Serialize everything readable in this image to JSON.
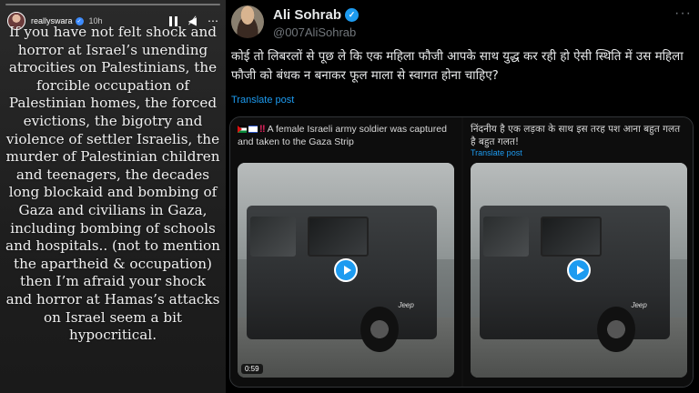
{
  "story": {
    "username": "reallyswara",
    "time": "10h",
    "text": "If you have not felt shock and horror at Israel’s unending atrocities on Palestinians, the forcible occupation of Palestinian homes, the forced evictions, the bigotry and violence of settler Israelis, the murder of Palestinian children and teenagers, the decades long blockaid and bombing of Gaza and civilians in Gaza, including bombing of schools and hospitals.. (not to mention the apartheid & occupation) then I’m afraid your shock and horror at Hamas’s attacks on Israel seem a bit hypocritical."
  },
  "tweet": {
    "name": "Ali Sohrab",
    "handle": "@007AliSohrab",
    "text": "कोई तो लिबरलों से पूछ ले कि एक महिला फौजी आपके साथ युद्ध कर रही हो ऐसी स्थिति में उस महिला फौजी को बंधक न बनाकर फूल माला से स्वागत होना चाहिए?",
    "translate_label": "Translate post",
    "media": {
      "left": {
        "caption": "A female Israeli army soldier was captured and taken to the Gaza Strip",
        "duration": "0:59",
        "jeep_label": "Jeep"
      },
      "right": {
        "caption": "निंदनीय है एक लड़का के साथ इस तरह पश आना बहुत गलत है बहुत गलत!",
        "translate_label": "Translate post",
        "jeep_label": "Jeep"
      }
    }
  },
  "colors": {
    "accent": "#1d9bf0",
    "background": "#000000",
    "muted": "#71767b"
  }
}
